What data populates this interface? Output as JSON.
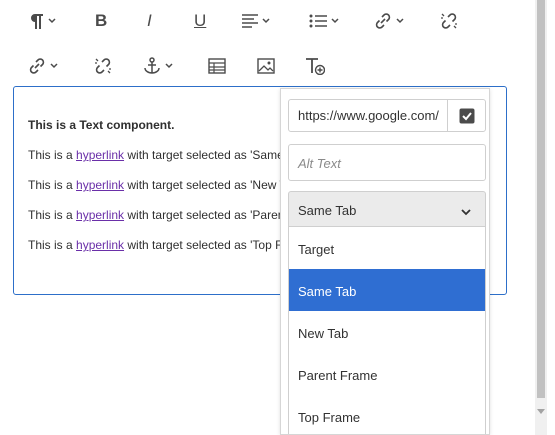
{
  "toolbar": {
    "row1": [
      "paragraph-icon",
      "bold-icon",
      "italic-icon",
      "underline-icon",
      "justify-icon",
      "list-icon",
      "link-icon",
      "unlink-icon"
    ],
    "row2": [
      "link-icon",
      "unlink-icon",
      "anchor-icon",
      "table-icon",
      "image-icon",
      "text-style-icon"
    ]
  },
  "editor": {
    "heading": "This is a Text component.",
    "lines": [
      {
        "pre": "This is a ",
        "link": "hyperlink",
        "post": " with target selected as 'Same"
      },
      {
        "pre": "This is a ",
        "link": "hyperlink",
        "post": " with target selected as 'New T"
      },
      {
        "pre": "This is a ",
        "link": "hyperlink",
        "post": " with target selected as 'Parent"
      },
      {
        "pre": "This is a ",
        "link": "hyperlink",
        "post": " with target selected as 'Top Fr"
      }
    ]
  },
  "link_dialog": {
    "url_value": "https://www.google.com/",
    "alt_placeholder": "Alt Text",
    "target_selected": "Same Tab",
    "options": [
      "Target",
      "Same Tab",
      "New Tab",
      "Parent Frame",
      "Top Frame"
    ],
    "selected_index": 1
  },
  "colors": {
    "accent": "#2f6ed2",
    "link": "#6a2fa8",
    "border": "#2d6fc9"
  }
}
